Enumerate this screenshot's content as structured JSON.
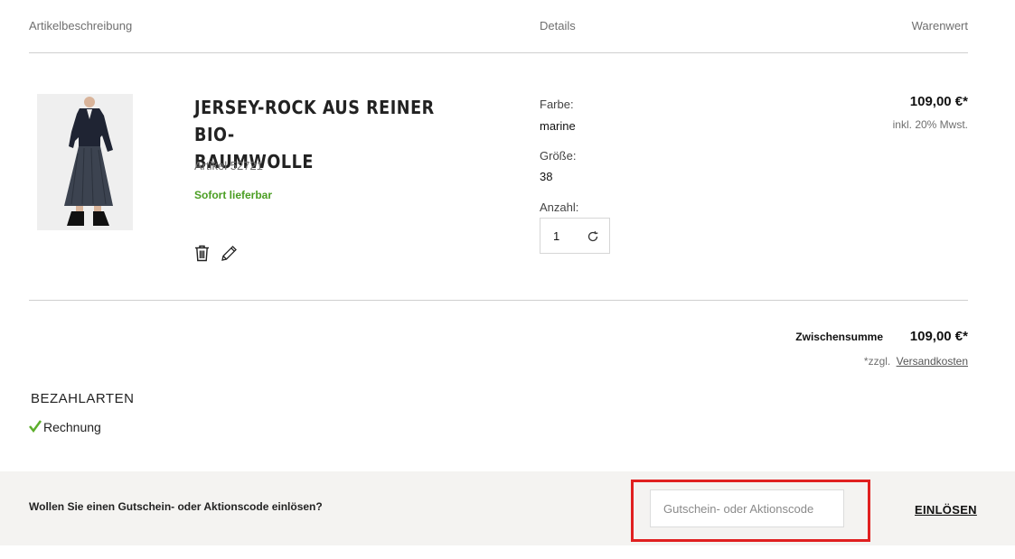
{
  "columns": {
    "description": "Artikelbeschreibung",
    "details": "Details",
    "value": "Warenwert"
  },
  "item": {
    "title_line1": "JERSEY-ROCK AUS REINER BIO-",
    "title_line2": "BAUMWOLLE",
    "article": "Artikel 52721",
    "availability": "Sofort lieferbar",
    "details": {
      "color_label": "Farbe:",
      "color_value": "marine",
      "size_label": "Größe:",
      "size_value": "38",
      "qty_label": "Anzahl:",
      "qty_value": "1"
    },
    "price": "109,00 €*",
    "tax_note": "inkl. 20% Mwst.",
    "icons": {
      "delete": "trash-icon",
      "edit": "pencil-icon",
      "refresh": "refresh-icon"
    }
  },
  "summary": {
    "subtotal_label": "Zwischensumme",
    "subtotal_value": "109,00 €*",
    "shipping_prefix": "*zzgl.",
    "shipping_link": "Versandkosten"
  },
  "payment": {
    "heading": "BEZAHLARTEN",
    "method": "Rechnung",
    "check_color": "#5cae2b"
  },
  "voucher": {
    "question": "Wollen Sie einen Gutschein- oder Aktionscode einlösen?",
    "input_placeholder": "Gutschein- oder Aktionscode",
    "input_value": "",
    "redeem_label": "EINLÖSEN",
    "highlight_color": "#e02020"
  }
}
